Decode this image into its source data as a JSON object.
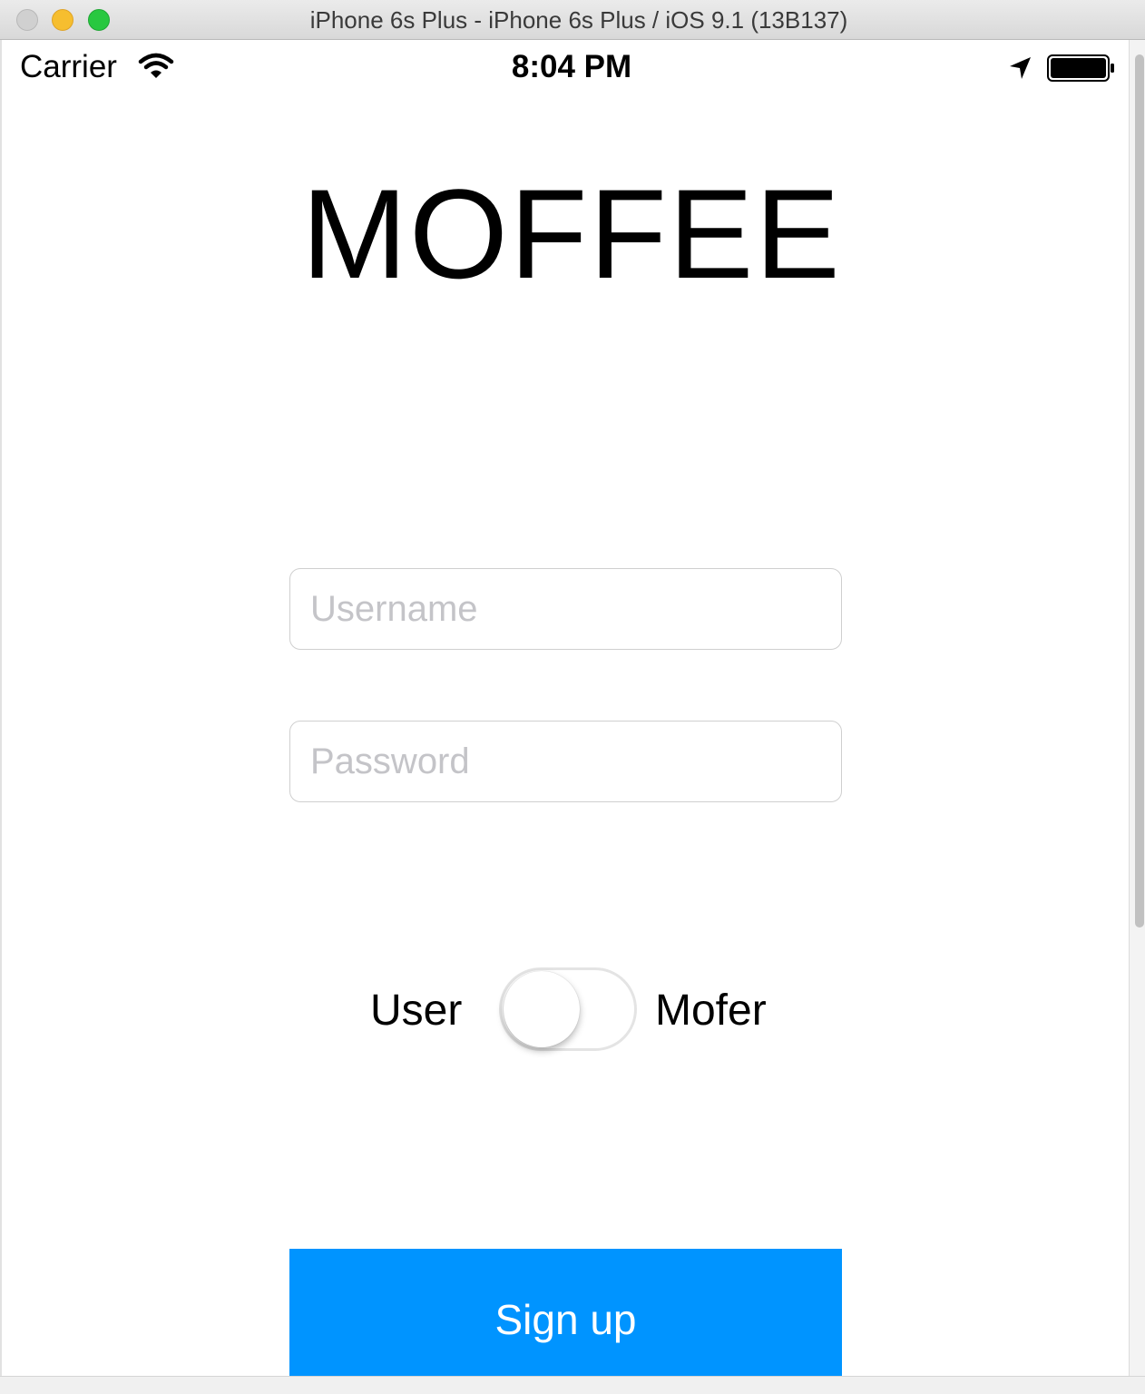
{
  "window": {
    "title": "iPhone 6s Plus - iPhone 6s Plus / iOS 9.1 (13B137)"
  },
  "status_bar": {
    "carrier": "Carrier",
    "time": "8:04 PM",
    "icons": [
      "wifi-icon",
      "location-arrow-icon",
      "battery-icon"
    ]
  },
  "app": {
    "logo": "MOFFEE",
    "username_placeholder": "Username",
    "password_placeholder": "Password",
    "username_value": "",
    "password_value": "",
    "toggle": {
      "left_label": "User",
      "right_label": "Mofer",
      "state": "off"
    },
    "signup_label": "Sign up",
    "accent_color": "#0094ff"
  }
}
